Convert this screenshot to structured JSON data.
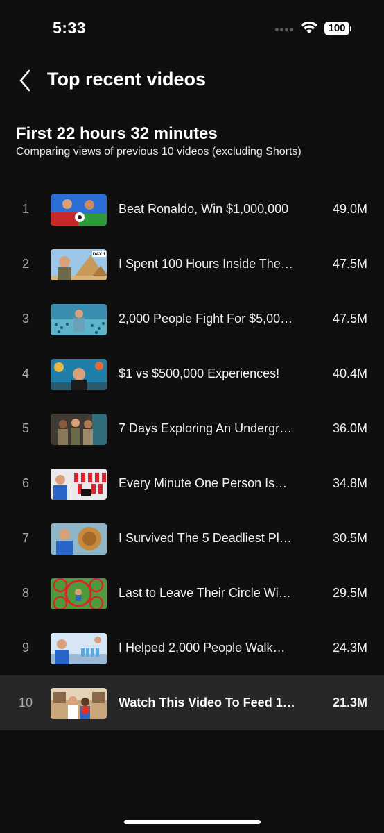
{
  "status_bar": {
    "time": "5:33",
    "battery": "100"
  },
  "header": {
    "title": "Top recent videos"
  },
  "summary": {
    "title": "First 22 hours 32 minutes",
    "subtitle": "Comparing views of previous 10 videos (excluding Shorts)"
  },
  "videos": [
    {
      "rank": "1",
      "title": "Beat Ronaldo, Win $1,000,000",
      "views": "49.0M"
    },
    {
      "rank": "2",
      "title": "I Spent 100 Hours Inside The…",
      "views": "47.5M"
    },
    {
      "rank": "3",
      "title": "2,000 People Fight For $5,00…",
      "views": "47.5M"
    },
    {
      "rank": "4",
      "title": "$1 vs $500,000 Experiences!",
      "views": "40.4M"
    },
    {
      "rank": "5",
      "title": "7 Days Exploring An Undergr…",
      "views": "36.0M"
    },
    {
      "rank": "6",
      "title": "Every Minute One Person Is…",
      "views": "34.8M"
    },
    {
      "rank": "7",
      "title": "I Survived The 5 Deadliest Pl…",
      "views": "30.5M"
    },
    {
      "rank": "8",
      "title": "Last to Leave Their Circle Wi…",
      "views": "29.5M"
    },
    {
      "rank": "9",
      "title": "I Helped 2,000 People Walk…",
      "views": "24.3M"
    },
    {
      "rank": "10",
      "title": "Watch This Video To Feed 1…",
      "views": "21.3M"
    }
  ],
  "thumbnail_badge": "DAY 1",
  "colors": {
    "background": "#0f0f0f",
    "highlight_row": "#272727",
    "secondary_text": "#aaaaaa"
  }
}
